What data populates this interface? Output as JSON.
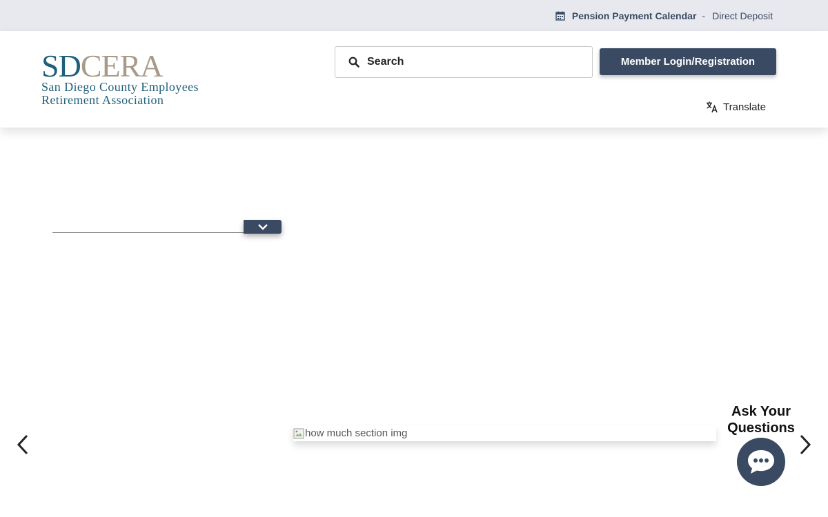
{
  "topbar": {
    "calendar_label": "Pension Payment Calendar",
    "separator": "-",
    "deposit_label": "Direct Deposit"
  },
  "logo": {
    "mark_blue_1": "SD",
    "mark_tan": "CERA",
    "line1": "San Diego County Employees",
    "line2": "Retirement Association"
  },
  "search": {
    "placeholder": "Search"
  },
  "login": {
    "label": "Member Login/Registration"
  },
  "translate": {
    "label": "Translate"
  },
  "section_image": {
    "alt": "how much section img"
  },
  "chat": {
    "line1": "Ask Your",
    "line2": "Questions"
  },
  "colors": {
    "navy": "#3a4a63",
    "brand_blue": "#1f5f7a",
    "brand_tan": "#a89a88",
    "topbar_bg": "#e8e9ee"
  },
  "icons": [
    "calendar-icon",
    "search-icon",
    "translate-icon",
    "chevron-down-icon",
    "chevron-left-icon",
    "chevron-right-icon",
    "broken-image-icon",
    "chat-icon"
  ]
}
